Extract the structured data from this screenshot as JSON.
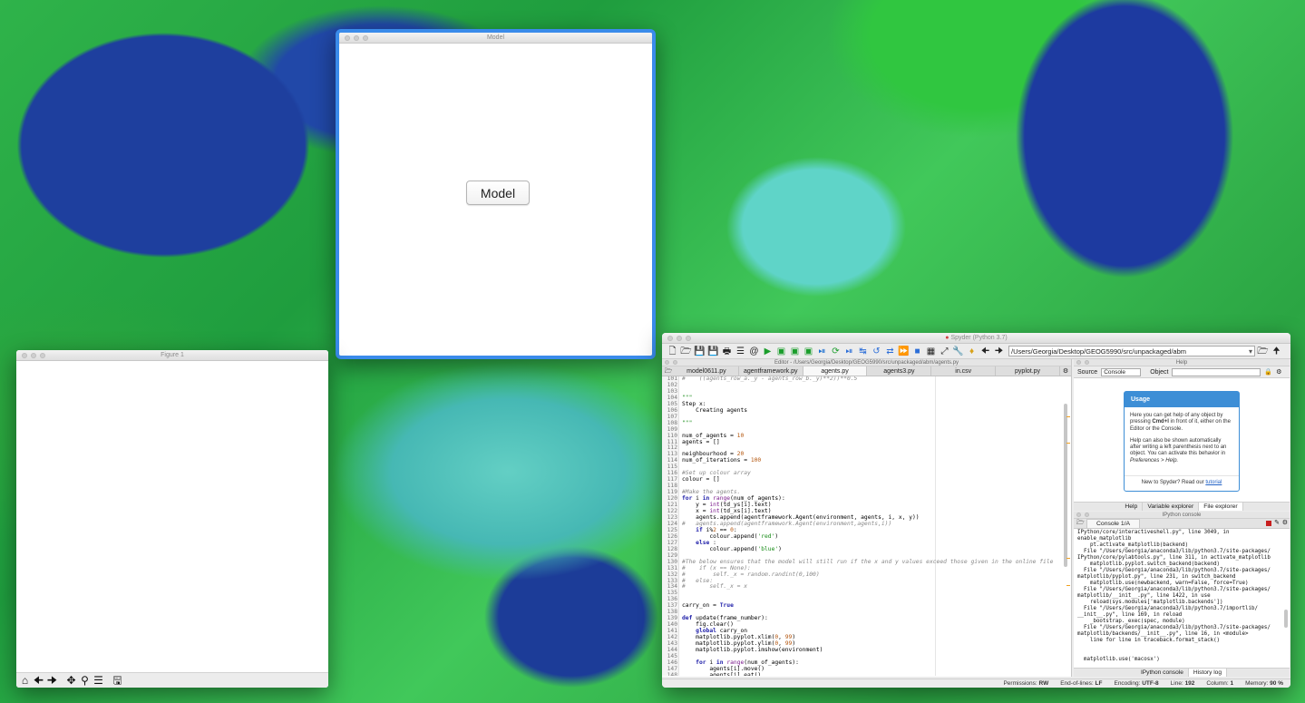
{
  "model_window": {
    "title": "Model",
    "button_label": "Model"
  },
  "figure_window": {
    "title": "Figure 1",
    "toolbar_icons": [
      "home-icon",
      "back-icon",
      "forward-icon",
      "pan-icon",
      "zoom-icon",
      "configure-icon",
      "save-icon"
    ]
  },
  "spyder": {
    "title": "Spyder (Python 3.7)",
    "path": "/Users/Georgia/Desktop/GEOG5990/src/unpackaged/abm",
    "editor_title": "Editor - /Users/Georgia/Desktop/GEOG5990/src/unpackaged/abm/agents.py",
    "tabs": [
      "model0611.py",
      "agentframework.py",
      "agents.py",
      "agents3.py",
      "in.csv",
      "pyplot.py"
    ],
    "active_tab": "agents.py",
    "line_numbers": [
      "101",
      "102",
      "103",
      "104",
      "105",
      "106",
      "107",
      "108",
      "109",
      "110",
      "111",
      "112",
      "113",
      "114",
      "115",
      "116",
      "117",
      "118",
      "119",
      "120",
      "121",
      "122",
      "123",
      "124",
      "125",
      "126",
      "127",
      "128",
      "129",
      "130",
      "131",
      "132",
      "133",
      "134",
      "135",
      "136",
      "137",
      "138",
      "139",
      "140",
      "141",
      "142",
      "143",
      "144",
      "145",
      "146",
      "147",
      "148"
    ],
    "code": [
      "#    ((agents_row_a._y - agents_row_b._y)**2))**0.5",
      "",
      "",
      "\"\"\"",
      "Step x:",
      "    Creating agents",
      "",
      "\"\"\"",
      "",
      "num_of_agents = 10",
      "agents = []",
      "",
      "neighbourhood = 20",
      "num_of_iterations = 100",
      "",
      "#Set up colour array",
      "colour = []",
      "",
      "#Make the agents.",
      "for i in range(num_of_agents):",
      "    y = int(td_ys[i].text)",
      "    x = int(td_xs[i].text)",
      "    agents.append(agentframework.Agent(environment, agents, i, x, y))",
      "#   agents.append(agentframework.Agent(environment,agents,i))",
      "    if i%2 == 0:",
      "        colour.append('red')",
      "    else :",
      "        colour.append('blue')",
      "",
      "#The below ensures that the model will still run if the x and y values exceed those given in the online file",
      "#    if (x == None):",
      "#        self._x = random.randint(0,100)",
      "#   else:",
      "#       self._x = x",
      "",
      "",
      "carry_on = True",
      "",
      "def update(frame_number):",
      "    fig.clear()",
      "    global carry_on",
      "    matplotlib.pyplot.xlim(0, 99)",
      "    matplotlib.pyplot.ylim(0, 99)",
      "    matplotlib.pyplot.imshow(environment)",
      "",
      "    for i in range(num_of_agents):",
      "        agents[i].move()",
      "        agents[i].eat()"
    ],
    "help": {
      "title": "Help",
      "source_label": "Source",
      "source_value": "Console",
      "object_label": "Object",
      "usage_title": "Usage",
      "usage_p1_a": "Here you can get help of any object by pressing ",
      "usage_p1_b": "Cmd+I",
      "usage_p1_c": " in front of it, either on the Editor or the Console.",
      "usage_p2": "Help can also be shown automatically after writing a left parenthesis next to an object. You can activate this behavior in ",
      "usage_p2_em": "Preferences > Help.",
      "usage_foot": "New to Spyder? Read our ",
      "usage_link": "tutorial",
      "tabs": [
        "Help",
        "Variable explorer",
        "File explorer"
      ]
    },
    "console": {
      "title": "IPython console",
      "tab": "Console 1/A",
      "output": [
        "IPython/core/interactiveshell.py\", line 3049, in",
        "enable_matplotlib",
        "    pt.activate_matplotlib(backend)",
        "  File \"/Users/Georgia/anaconda3/lib/python3.7/site-packages/",
        "IPython/core/pylabtools.py\", line 311, in activate_matplotlib",
        "    matplotlib.pyplot.switch_backend(backend)",
        "  File \"/Users/Georgia/anaconda3/lib/python3.7/site-packages/",
        "matplotlib/pyplot.py\", line 231, in switch_backend",
        "    matplotlib.use(newbackend, warn=False, force=True)",
        "  File \"/Users/Georgia/anaconda3/lib/python3.7/site-packages/",
        "matplotlib/__init__.py\", line 1422, in use",
        "    reload(sys.modules['matplotlib.backends'])",
        "  File \"/Users/Georgia/anaconda3/lib/python3.7/importlib/",
        "__init__.py\", line 169, in reload",
        "    _bootstrap._exec(spec, module)",
        "  File \"/Users/Georgia/anaconda3/lib/python3.7/site-packages/",
        "matplotlib/backends/__init__.py\", line 16, in <module>",
        "    line for line in traceback.format_stack()",
        "",
        "",
        "  matplotlib.use('macosx')"
      ],
      "tabs": [
        "IPython console",
        "History log"
      ]
    },
    "status": {
      "permissions_label": "Permissions:",
      "permissions": "RW",
      "eol_label": "End-of-lines:",
      "eol": "LF",
      "encoding_label": "Encoding:",
      "encoding": "UTF-8",
      "line_label": "Line:",
      "line": "192",
      "column_label": "Column:",
      "column": "1",
      "memory_label": "Memory:",
      "memory": "90 %"
    }
  }
}
